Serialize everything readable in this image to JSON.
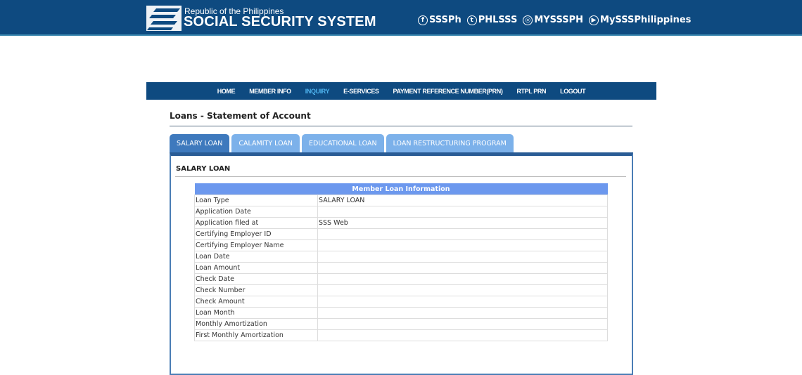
{
  "header": {
    "republic": "Republic of the Philippines",
    "agency": "SOCIAL SECURITY SYSTEM",
    "social": [
      {
        "icon": "facebook-icon",
        "glyph": "f",
        "label": "SSSPh"
      },
      {
        "icon": "twitter-icon",
        "glyph": "t",
        "label": "PHLSSS"
      },
      {
        "icon": "instagram-icon",
        "glyph": "◎",
        "label": "MYSSSPH"
      },
      {
        "icon": "youtube-icon",
        "glyph": "▶",
        "label": "MySSSPhilippines"
      }
    ]
  },
  "nav": [
    "HOME",
    "MEMBER INFO",
    "INQUIRY",
    "E-SERVICES",
    "PAYMENT REFERENCE NUMBER(PRN)",
    "RTPL PRN",
    "LOGOUT"
  ],
  "nav_active": "INQUIRY",
  "page_title": "Loans - Statement of Account",
  "tabs": [
    "SALARY LOAN",
    "CALAMITY LOAN",
    "EDUCATIONAL LOAN",
    "LOAN RESTRUCTURING PROGRAM"
  ],
  "panel": {
    "title": "SALARY LOAN",
    "table_header": "Member Loan Information",
    "rows": [
      [
        "Loan Type",
        "SALARY LOAN"
      ],
      [
        "Application Date",
        ""
      ],
      [
        "Application filed at",
        "SSS Web"
      ],
      [
        "Certifying Employer ID",
        ""
      ],
      [
        "Certifying Employer Name",
        ""
      ],
      [
        "Loan Date",
        ""
      ],
      [
        "Loan Amount",
        ""
      ],
      [
        "Check Date",
        ""
      ],
      [
        "Check Number",
        ""
      ],
      [
        "Check Amount",
        ""
      ],
      [
        "Loan Month",
        ""
      ],
      [
        "Monthly Amortization",
        ""
      ],
      [
        "First Monthly Amortization",
        ""
      ]
    ]
  },
  "colors": {
    "header": "#0e4a80",
    "nav_active": "#4fb3ee",
    "tab_active": "#3e79bd",
    "tab": "#7cb1ea",
    "table_header": "#6c98ee"
  }
}
